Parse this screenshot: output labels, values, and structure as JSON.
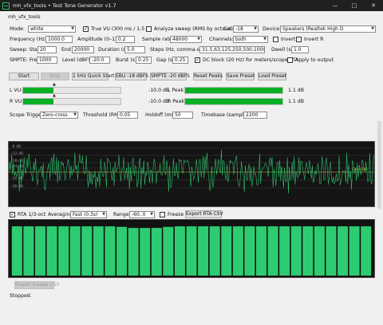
{
  "window": {
    "title": "mh_vfx_tools • Test Tone Generator v1.7",
    "subtitle": "mh_vfx_tools",
    "minimize_glyph": "—",
    "maximize_glyph": "□",
    "close_glyph": "✕"
  },
  "row1": {
    "mode_label": "Mode:",
    "mode_value": "white",
    "true_vu_label": "True VU (300 ms / 1.5 s)",
    "true_vu_checked": true,
    "analyze_label": "Analyze sweep (RMS by octave)",
    "analyze_checked": false,
    "cal_label": "Cal:",
    "cal_value": "-18",
    "device_label": "Device:",
    "device_value": "Speakers (Realtek High D"
  },
  "row2": {
    "freq_label": "Frequency (Hz):",
    "freq_value": "1000.0",
    "amp_label": "Amplitude (0–1):",
    "amp_value": "0.2",
    "sr_label": "Sample rate:",
    "sr_value": "48000",
    "channels_label": "Channels:",
    "channels_value": "both",
    "invert_l_label": "Invert L",
    "invert_r_label": "Invert R"
  },
  "row3": {
    "sweep_start_label": "Sweep: Start",
    "sweep_start_value": "20",
    "end_label": "End",
    "end_value": "20000",
    "duration_label": "Duration (s)",
    "duration_value": "5.0",
    "steps_label": "Steps (Hz, comma-sep)",
    "steps_value": "31.5,63,125,250,500,1000,2000,40",
    "dwell_label": "Dwell (s)",
    "dwell_value": "1.0"
  },
  "row4": {
    "smpte_label": "SMPTE: Freq",
    "smpte_value": "1000",
    "level_label": "Level (dBFS)",
    "level_value": "-20.0",
    "burst_label": "Burst (s)",
    "burst_value": "0.25",
    "gap_label": "Gap (s)",
    "gap_value": "0.25",
    "dc_label": "DC block (20 Hz) for meters/scope/RTA",
    "dc_checked": true,
    "apply_label": "Apply to output",
    "apply_checked": false
  },
  "buttons": {
    "start": "Start",
    "stop": "Stop",
    "quick": "1 kHz Quick Start",
    "ebu": "EBU -18 dBFS",
    "smpte": "SMPTE -20 dBFS",
    "reset_peaks": "Reset Peaks",
    "save_preset": "Save Preset",
    "load_preset": "Load Preset"
  },
  "meters": {
    "l_vu_label": "L VU:",
    "l_vu_db": "-10.0 dB",
    "l_vu_fill": 0.31,
    "l_peak_label": "L Peak:",
    "l_peak_db": "1.1 dB",
    "l_peak_fill": 1.0,
    "r_vu_label": "R VU:",
    "r_vu_db": "-10.0 dB",
    "r_vu_fill": 0.31,
    "r_peak_label": "R Peak:",
    "r_peak_db": "1.1 dB",
    "r_peak_fill": 1.0,
    "marker_glyph": "▲"
  },
  "scope": {
    "trigger_label": "Scope Trigger:",
    "trigger_value": "Zero-cross",
    "threshold_label": "Threshold (RMS):",
    "threshold_value": "0.05",
    "holdoff_label": "Holdoff (ms):",
    "holdoff_value": "50",
    "timebase_label": "Timebase (samples):",
    "timebase_value": "2200",
    "grid_labels": [
      "-6 dB",
      "-12 dB",
      "-18 dB",
      "-24 dB",
      "-30 dB",
      "-36 dB"
    ],
    "cal_line_label": "Cal (-18)",
    "trace_color": "#2ecc71",
    "grid_color": "#3a3a3a",
    "cal_color": "#d4c23a"
  },
  "rta": {
    "enable_label": "RTA 1/3-oct",
    "enable_checked": true,
    "averaging_label": "Averaging:",
    "averaging_value": "Fast (0.3s)",
    "range_label": "Range:",
    "range_value": "-60..0",
    "freeze_label": "Freeze",
    "freeze_checked": false,
    "export_label": "Export RTA CSV",
    "bar_count": 31,
    "bar_levels": [
      0.91,
      0.91,
      0.91,
      0.91,
      0.91,
      0.91,
      0.91,
      0.91,
      0.91,
      0.9,
      0.88,
      0.88,
      0.88,
      0.9,
      0.91,
      0.91,
      0.91,
      0.91,
      0.91,
      0.91,
      0.91,
      0.91,
      0.91,
      0.91,
      0.91,
      0.91,
      0.91,
      0.91,
      0.91,
      0.91,
      0.91
    ],
    "bar_color": "#2ecc71"
  },
  "footer": {
    "export_sweep_label": "Export Sweep CSV",
    "status": "Stopped."
  }
}
